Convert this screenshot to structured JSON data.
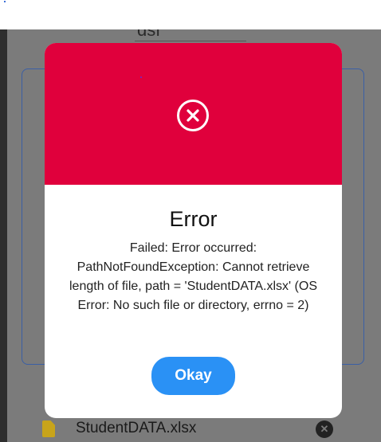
{
  "background": {
    "title_fragment": "dsf",
    "file": {
      "name": "StudentDATA.xlsx",
      "icon": "file-icon",
      "remove_icon": "close-circle-icon"
    }
  },
  "dialog": {
    "icon": "close-circle-icon",
    "title": "Error",
    "message": "Failed: Error occurred: PathNotFoundException: Cannot retrieve length of file, path = 'StudentDATA.xlsx' (OS Error: No such file or directory, errno = 2)",
    "button_label": "Okay"
  },
  "colors": {
    "header": "#e0003c",
    "button": "#2a91f5",
    "overlay": "#7b7b7b"
  }
}
